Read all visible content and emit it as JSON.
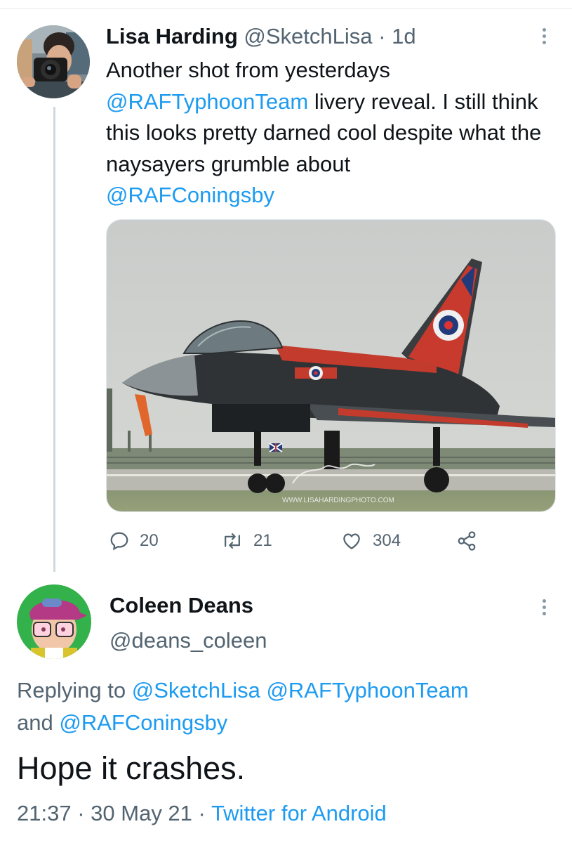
{
  "tweet": {
    "author_name": "Lisa Harding",
    "author_handle": "@SketchLisa",
    "separator": "·",
    "age": "1d",
    "text_1": "Another shot from yesterdays",
    "mention_1": "@RAFTyphoonTeam",
    "text_2": " livery reveal. I still think this looks pretty darned cool despite what the naysayers grumble about",
    "mention_2": "@RAFConingsby",
    "media": {
      "watermark": "WWW.LISAHARDINGPHOTO.COM",
      "signature": "Lisa Harding"
    },
    "actions": {
      "reply_count": "20",
      "retweet_count": "21",
      "like_count": "304"
    }
  },
  "reply": {
    "author_name": "Coleen Deans",
    "author_handle": "@deans_coleen",
    "replying_prefix": "Replying to ",
    "replying_mention_1": "@SketchLisa",
    "replying_mention_2": "@RAFTyphoonTeam",
    "replying_and": "and",
    "replying_mention_3": "@RAFConingsby",
    "text": "Hope it crashes.",
    "time": "21:37",
    "date": "30 May 21",
    "separator": "·",
    "source": "Twitter for Android"
  },
  "colors": {
    "link": "#1d9bf0",
    "muted": "#536471",
    "text": "#0f1419",
    "thread_line": "#cfd9de"
  },
  "icons": [
    "reply-icon",
    "retweet-icon",
    "like-icon",
    "share-icon",
    "more-icon"
  ]
}
